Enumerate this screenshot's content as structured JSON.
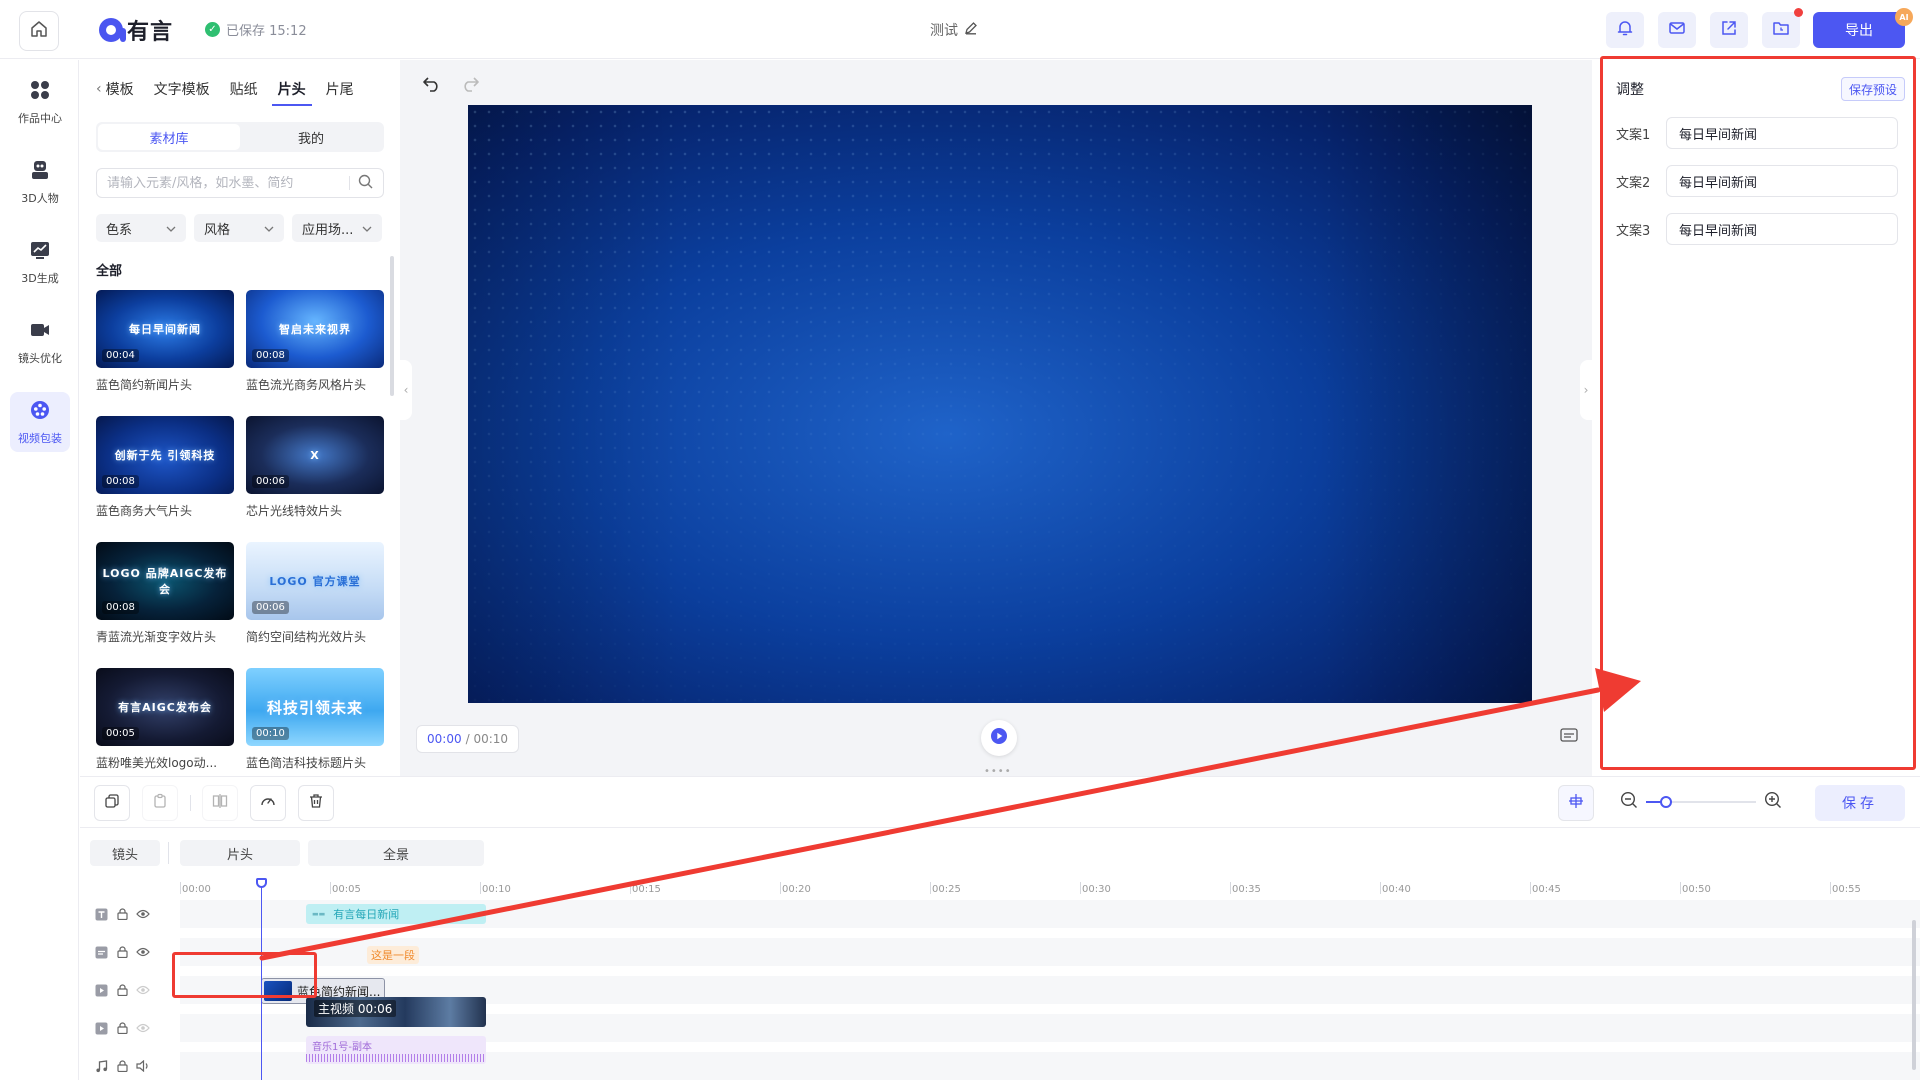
{
  "header": {
    "logo_text": "有言",
    "saved_text": "已保存 15:12",
    "doc_title": "测试",
    "export_label": "导出",
    "ai_badge": "AI",
    "icons": [
      "bell-icon",
      "mail-icon",
      "share-icon",
      "folder-icon"
    ]
  },
  "nav": [
    {
      "label": "作品中心",
      "icon": "grid-icon"
    },
    {
      "label": "3D人物",
      "icon": "robot-icon"
    },
    {
      "label": "3D生成",
      "icon": "chart-icon"
    },
    {
      "label": "镜头优化",
      "icon": "camera-icon"
    },
    {
      "label": "视频包装",
      "icon": "palette-icon",
      "active": true
    }
  ],
  "panel": {
    "tabs": [
      "模板",
      "文字模板",
      "贴纸",
      "片头",
      "片尾"
    ],
    "active_tab": "片头",
    "segments": [
      "素材库",
      "我的"
    ],
    "search_placeholder": "请输入元素/风格，如水墨、简约",
    "filters": [
      "色系",
      "风格",
      "应用场..."
    ],
    "section_title": "全部",
    "cards": [
      {
        "label": "蓝色简约新闻片头",
        "duration": "00:04",
        "thumb_text": "每日早间新闻",
        "style": "blue-dark"
      },
      {
        "label": "蓝色流光商务风格片头",
        "duration": "00:08",
        "thumb_text": "智启未来视界",
        "style": "blue-light"
      },
      {
        "label": "蓝色商务大气片头",
        "duration": "00:08",
        "thumb_text": "创新于先 引领科技",
        "style": "blue-deep"
      },
      {
        "label": "芯片光线特效片头",
        "duration": "00:06",
        "thumb_text": "X",
        "style": "chip"
      },
      {
        "label": "青蓝流光渐变字效片头",
        "duration": "00:08",
        "thumb_text": "LOGO 品牌AIGC发布会",
        "style": "teal-dark"
      },
      {
        "label": "简约空间结构光效片头",
        "duration": "00:06",
        "thumb_text": "LOGO 官方课堂",
        "style": "sky"
      },
      {
        "label": "蓝粉唯美光效logo动...",
        "duration": "00:05",
        "thumb_text": "有言AIGC发布会",
        "style": "navy"
      },
      {
        "label": "蓝色简洁科技标题片头",
        "duration": "00:10",
        "thumb_text": "科技引领未来",
        "style": "cyan"
      }
    ]
  },
  "preview": {
    "time_current": "00:00",
    "time_total": "/ 00:10"
  },
  "adjust": {
    "title": "调整",
    "preset_label": "保存预设",
    "fields": [
      {
        "label": "文案1",
        "value": "每日早间新闻"
      },
      {
        "label": "文案2",
        "value": "每日早间新闻"
      },
      {
        "label": "文案3",
        "value": "每日早间新闻"
      }
    ]
  },
  "toolbar": {
    "save_label": "保存",
    "zoom_level": 0.18
  },
  "timeline": {
    "tabs": [
      "镜头",
      "片头",
      "全景"
    ],
    "ticks": [
      "00:00",
      "00:05",
      "00:10",
      "00:15",
      "00:20",
      "00:25",
      "00:30",
      "00:35",
      "00:40",
      "00:45",
      "00:50",
      "00:55"
    ],
    "clips": {
      "text_clip": "有言每日新闻",
      "subtitle_clip": "这是一段",
      "intro_clip": "蓝色简约新闻...",
      "main_clip": "主视频 00:06",
      "music_clip": "音乐1号-副本"
    }
  },
  "colors": {
    "accent": "#4c57f2",
    "highlight": "#ef3b32"
  }
}
